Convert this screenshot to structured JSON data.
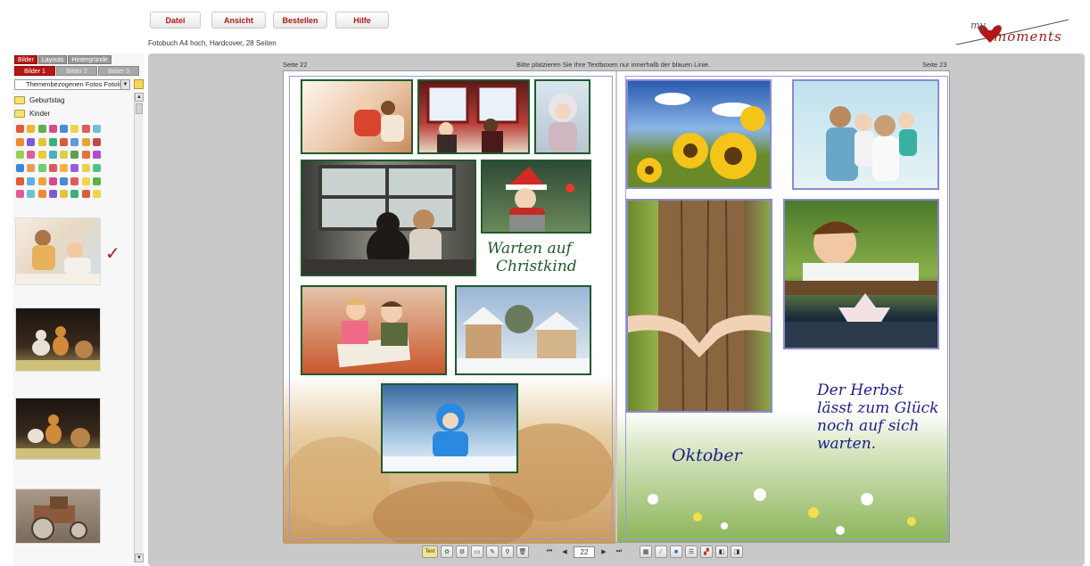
{
  "menu": {
    "datei": "Datei",
    "ansicht": "Ansicht",
    "bestellen": "Bestellen",
    "hilfe": "Hilfe"
  },
  "subtitle": "Fotobuch A4 hoch, Hardcover, 28 Seiten",
  "logo": {
    "my": "my",
    "moments": "moments"
  },
  "left": {
    "tabs": [
      "Bilder",
      "Layouts",
      "Hintergründe"
    ],
    "subtabs": [
      "Bilder 1",
      "Bilder 2",
      "Bilder 3"
    ],
    "folder_select": "Themenbezogenen Fotos Fotolia",
    "folders": [
      "Geburtstag",
      "Kinder"
    ]
  },
  "workarea": {
    "left_page_label": "Seite 22",
    "right_page_label": "Seite 23",
    "hint": "Bitte platzieren Sie Ihre Textboxen nur innerhalb der blauen Linie.",
    "left_caption_1": "Warten auf",
    "left_caption_2": "Christkind",
    "right_month": "Oktober",
    "right_quote_1": "Der Herbst",
    "right_quote_2": "lässt zum Glück",
    "right_quote_3": "noch auf sich",
    "right_quote_4": "warten."
  },
  "toolbar": {
    "text_button": "Text",
    "page_number": "22"
  },
  "colors": {
    "accent": "#b81515",
    "photo_border": "#1f5a2c",
    "guide_line": "#9a9ad8",
    "workarea_bg": "#c9c9c9"
  }
}
